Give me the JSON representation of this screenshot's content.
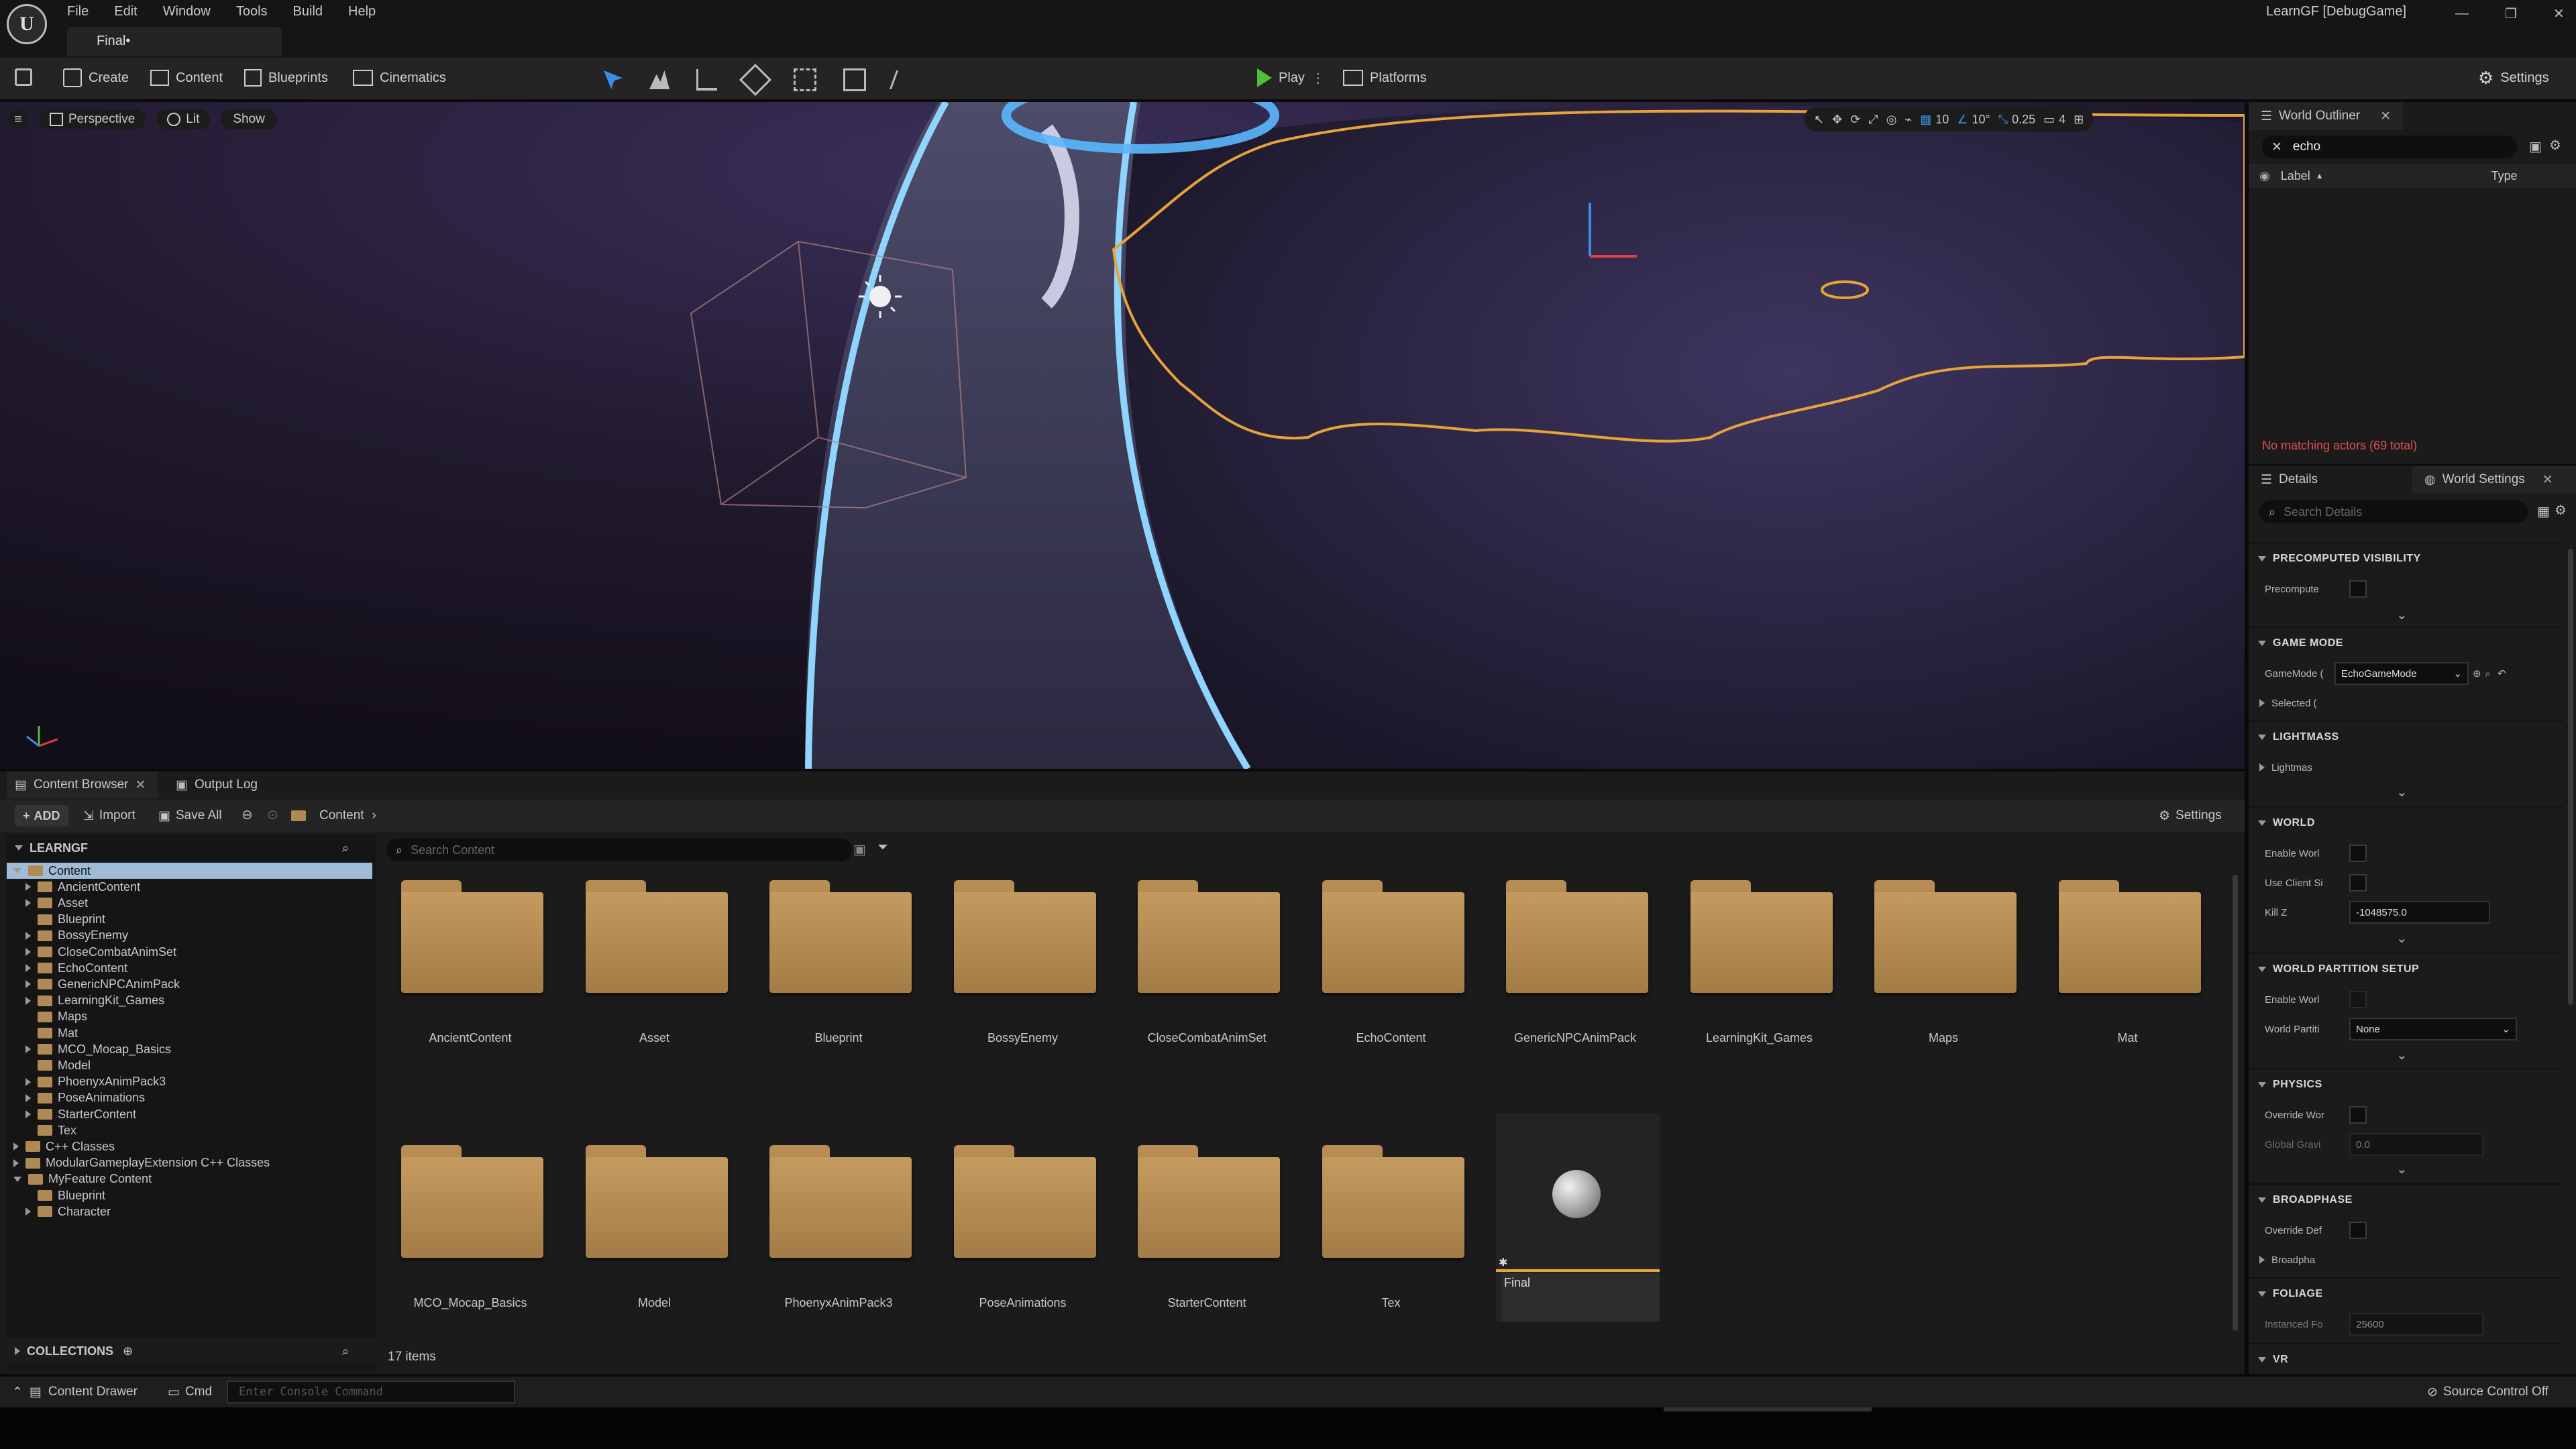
{
  "menubar": {
    "items": [
      "File",
      "Edit",
      "Window",
      "Tools",
      "Build",
      "Help"
    ],
    "project_tab": "Final•",
    "project_name": "LearnGF [DebugGame]"
  },
  "toolbar": {
    "create": "Create",
    "content": "Content",
    "blueprints": "Blueprints",
    "cinematics": "Cinematics",
    "play": "Play",
    "platforms": "Platforms",
    "settings": "Settings"
  },
  "viewport": {
    "perspective": "Perspective",
    "lit": "Lit",
    "show": "Show",
    "grid_snap": "10",
    "rot_snap": "10°",
    "scale_snap": "0.25",
    "camera_speed": "4"
  },
  "outliner": {
    "title": "World Outliner",
    "search_value": "echo",
    "col_label": "Label",
    "col_type": "Type",
    "status": "No matching actors (69 total)"
  },
  "details": {
    "tab_details": "Details",
    "tab_world_settings": "World Settings",
    "search_placeholder": "Search Details",
    "sections": {
      "precomputed": "PRECOMPUTED VISIBILITY",
      "precompute": "Precompute",
      "game_mode": "GAME MODE",
      "game_mode_label": "GameMode (",
      "game_mode_value": "EchoGameMode",
      "selected": "Selected (",
      "lightmass": "LIGHTMASS",
      "lightmass_row": "Lightmas",
      "world": "WORLD",
      "enable_world": "Enable Worl",
      "use_client": "Use Client Si",
      "kill_z": "Kill Z",
      "kill_z_value": "-1048575.0",
      "wp_setup": "WORLD PARTITION SETUP",
      "enable_wp": "Enable Worl",
      "world_partition": "World Partiti",
      "wp_value": "None",
      "physics": "PHYSICS",
      "override_world": "Override Wor",
      "global_gravity": "Global Gravi",
      "gravity_value": "0.0",
      "broadphase": "BROADPHASE",
      "override_def": "Override Def",
      "broadphase_row": "Broadpha",
      "foliage": "FOLIAGE",
      "instanced": "Instanced Fo",
      "instanced_value": "25600",
      "vr": "VR"
    }
  },
  "content_browser": {
    "tab": "Content Browser",
    "output_log": "Output Log",
    "add": "ADD",
    "import": "Import",
    "save_all": "Save All",
    "path": "Content",
    "settings": "Settings",
    "root": "LEARNGF",
    "search_placeholder": "Search Content",
    "collections": "COLLECTIONS",
    "item_count": "17 items",
    "tree": [
      {
        "label": "Content",
        "depth": 0,
        "state": "open"
      },
      {
        "label": "AncientContent",
        "depth": 1,
        "state": "closed"
      },
      {
        "label": "Asset",
        "depth": 1,
        "state": "closed"
      },
      {
        "label": "Blueprint",
        "depth": 1,
        "state": "none"
      },
      {
        "label": "BossyEnemy",
        "depth": 1,
        "state": "closed"
      },
      {
        "label": "CloseCombatAnimSet",
        "depth": 1,
        "state": "closed"
      },
      {
        "label": "EchoContent",
        "depth": 1,
        "state": "closed"
      },
      {
        "label": "GenericNPCAnimPack",
        "depth": 1,
        "state": "closed"
      },
      {
        "label": "LearningKit_Games",
        "depth": 1,
        "state": "closed"
      },
      {
        "label": "Maps",
        "depth": 1,
        "state": "none"
      },
      {
        "label": "Mat",
        "depth": 1,
        "state": "none"
      },
      {
        "label": "MCO_Mocap_Basics",
        "depth": 1,
        "state": "closed"
      },
      {
        "label": "Model",
        "depth": 1,
        "state": "none"
      },
      {
        "label": "PhoenyxAnimPack3",
        "depth": 1,
        "state": "closed"
      },
      {
        "label": "PoseAnimations",
        "depth": 1,
        "state": "closed"
      },
      {
        "label": "StarterContent",
        "depth": 1,
        "state": "closed"
      },
      {
        "label": "Tex",
        "depth": 1,
        "state": "none"
      },
      {
        "label": "C++ Classes",
        "depth": 0,
        "state": "closed"
      },
      {
        "label": "ModularGameplayExtension C++ Classes",
        "depth": 0,
        "state": "closed"
      },
      {
        "label": "MyFeature Content",
        "depth": 0,
        "state": "open"
      },
      {
        "label": "Blueprint",
        "depth": 1,
        "state": "none"
      },
      {
        "label": "Character",
        "depth": 1,
        "state": "closed"
      }
    ],
    "folders": [
      "AncientContent",
      "Asset",
      "Blueprint",
      "BossyEnemy",
      "CloseCombatAnimSet",
      "EchoContent",
      "GenericNPCAnimPack",
      "LearningKit_Games",
      "Maps",
      "Mat",
      "MCO_Mocap_Basics",
      "Model",
      "PhoenyxAnimPack3",
      "PoseAnimations",
      "StarterContent",
      "Tex"
    ],
    "map_asset": "Final"
  },
  "statusbar": {
    "content_drawer": "Content Drawer",
    "cmd": "Cmd",
    "console_placeholder": "Enter Console Command",
    "source_control": "Source Control Off"
  }
}
